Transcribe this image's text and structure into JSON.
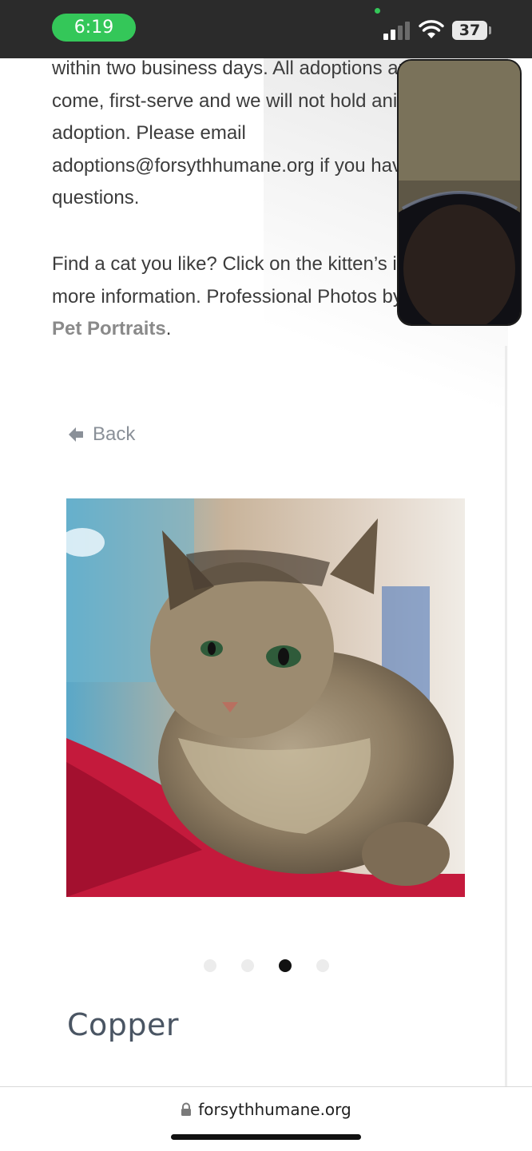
{
  "status_bar": {
    "time": "6:19",
    "battery_level": "37",
    "icons": [
      "cellular-signal-icon",
      "wifi-icon",
      "battery-icon"
    ],
    "accent_color": "#34c759"
  },
  "article": {
    "paragraph_1_lines": [
      "within two business days.  All adoptions are first-",
      "come, first-serve and we will not hold animals for",
      "adoption. Please email",
      "adoptions@forsythhumane.org if you have",
      "questions."
    ],
    "paragraph_2_lines": [
      "Find a cat you like? Click on the kitten’s image for",
      "more information. Professional Photos by"
    ],
    "photo_credit_link": "Pet Portraits",
    "photo_credit_suffix": "."
  },
  "navigation": {
    "back_label": "Back",
    "back_icon": "arrow-left-icon"
  },
  "gallery": {
    "image_alt": "tabby cat lying on red blanket",
    "dot_count": 4,
    "active_index": 2
  },
  "pet": {
    "name": "Copper"
  },
  "browser": {
    "url": "forsythhumane.org",
    "lock_icon": "lock-icon"
  },
  "colors": {
    "body_text": "#3c3c3c",
    "link_text": "#8a8a8a",
    "pet_name": "#4a5563",
    "status_bar_bg": "#2b2b2b"
  }
}
